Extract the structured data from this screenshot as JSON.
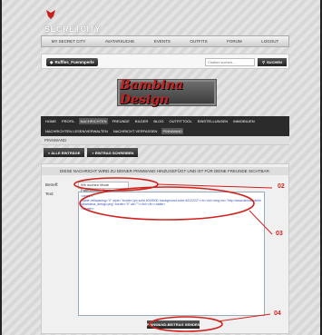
{
  "site": {
    "logo_text": "SECRETCITY"
  },
  "nav": [
    "MY SECRET CITY",
    "AVATARSUCHE",
    "EVENTS",
    "OUTFITS",
    "FORUM",
    "LOGOUT"
  ],
  "userbar": {
    "username": "Ruffles_Fuenmperle",
    "search_placeholder": "Chatter suchen...",
    "search_button": "SUCHEN"
  },
  "banner": {
    "title": "Bambina Design"
  },
  "profile_nav": {
    "row1": [
      "HOME",
      "PROFIL",
      "NACHRICHTEN",
      "FREUNDE",
      "BILDER",
      "BLOG",
      "OUTFITTOOL",
      "EINSTELLUNGEN",
      "IMMOBILIEN"
    ],
    "row2": [
      "NACHRICHTEN LESEN/VERWALTEN",
      "NACHRICHT VERFASSEN",
      "PINNWAND"
    ]
  },
  "section": {
    "title": "PINNWAND"
  },
  "tabs": [
    "« ALLE EINTRÄGE",
    "» EINTRAG SCHREIBEN"
  ],
  "panel": {
    "notice": "DIESE NACHRICHT WIRD ZU DEINER PINNWAND HINZUGEFÜGT UND IST FÜR DEINE FREUNDE SICHTBAR.",
    "subject_label": "Betreff:",
    "subject_value": "Wir suchen Mode Patenbringer Bwdz...",
    "text_label": "Text:",
    "text_value": "<center>\n<table cellspacing=\"0\" style=\"border:1px solid #000000; background-color:#222222\"><tr><td><img src=\"http://www.abload.de/img/bambina_design.png\" border=\"0\" alt=\"\"></td></tr></table>\n</center>",
    "submit_label": "PINNWAND-BEITRAG SENDEN"
  },
  "annotations": [
    "02",
    "03",
    "04"
  ],
  "colors": {
    "annotation": "#d0221d",
    "accent": "#c42222",
    "dark_bar": "#2b2b2b"
  }
}
